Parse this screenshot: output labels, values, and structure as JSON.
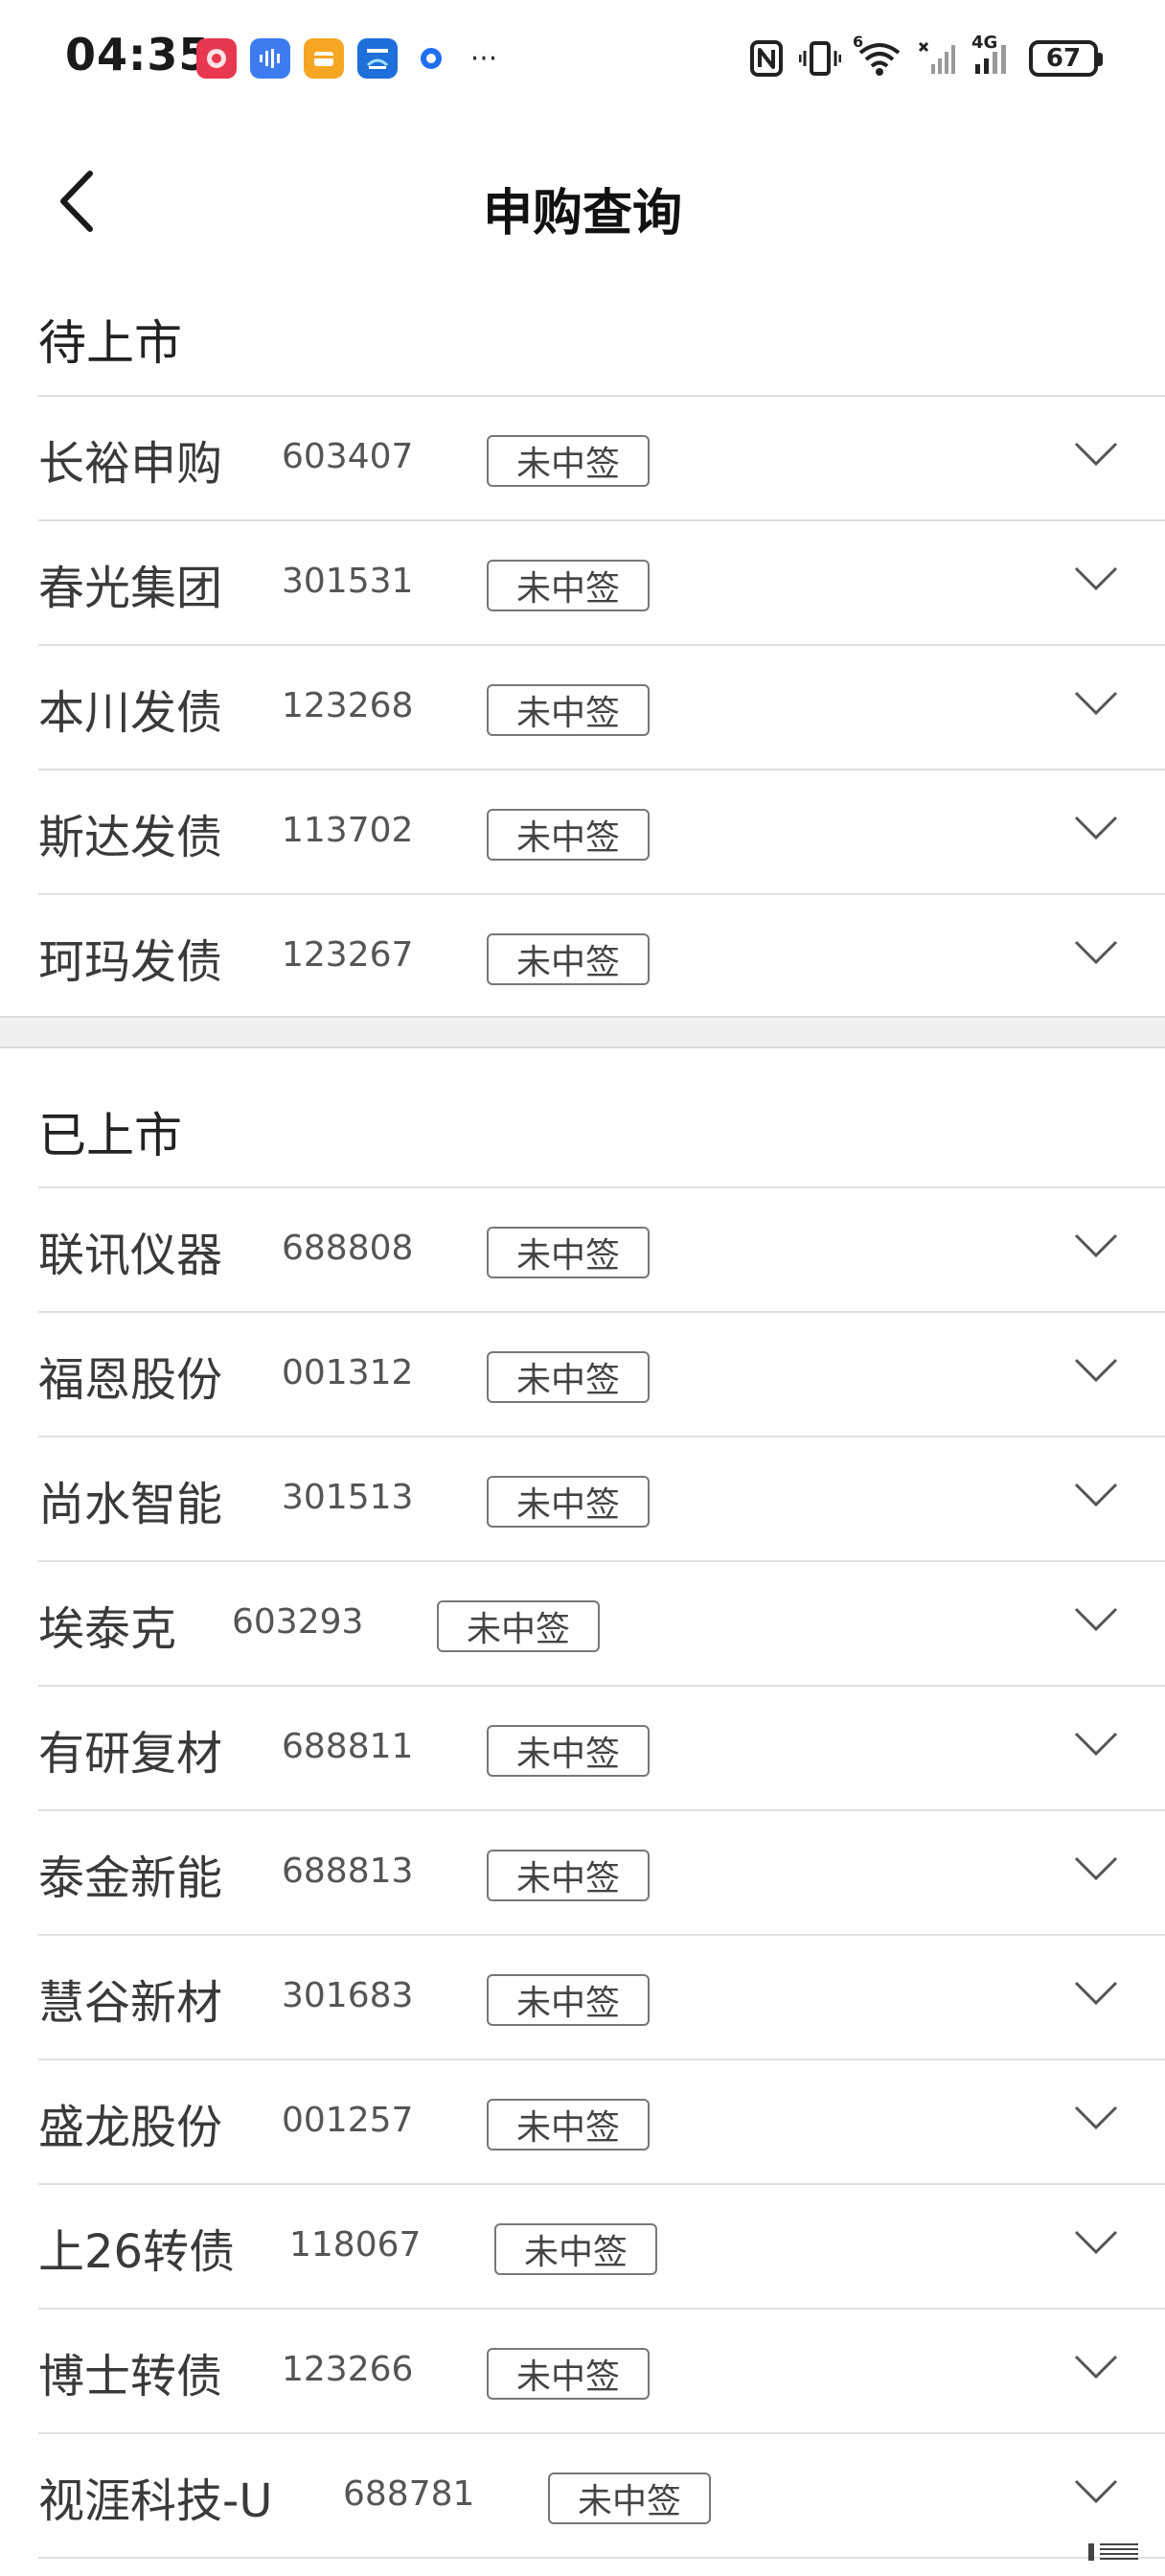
{
  "status_bar": {
    "time": "04:35",
    "more": "···",
    "network": "4G",
    "wifi_badge": "6",
    "battery": "67"
  },
  "header": {
    "title": "申购查询"
  },
  "pending": {
    "title": "待上市",
    "items": [
      {
        "name": "长裕申购",
        "code": "603407",
        "status": "未中签"
      },
      {
        "name": "春光集团",
        "code": "301531",
        "status": "未中签"
      },
      {
        "name": "本川发债",
        "code": "123268",
        "status": "未中签"
      },
      {
        "name": "斯达发债",
        "code": "113702",
        "status": "未中签"
      },
      {
        "name": "珂玛发债",
        "code": "123267",
        "status": "未中签"
      }
    ]
  },
  "listed": {
    "title": "已上市",
    "items": [
      {
        "name": "联讯仪器",
        "code": "688808",
        "status": "未中签"
      },
      {
        "name": "福恩股份",
        "code": "001312",
        "status": "未中签"
      },
      {
        "name": "尚水智能",
        "code": "301513",
        "status": "未中签"
      },
      {
        "name": "埃泰克",
        "code": "603293",
        "status": "未中签"
      },
      {
        "name": "有研复材",
        "code": "688811",
        "status": "未中签"
      },
      {
        "name": "泰金新能",
        "code": "688813",
        "status": "未中签"
      },
      {
        "name": "慧谷新材",
        "code": "301683",
        "status": "未中签"
      },
      {
        "name": "盛龙股份",
        "code": "001257",
        "status": "未中签"
      },
      {
        "name": "上26转债",
        "code": "118067",
        "status": "未中签"
      },
      {
        "name": "博士转债",
        "code": "123266",
        "status": "未中签"
      },
      {
        "name": "视涯科技-U",
        "code": "688781",
        "status": "未中签"
      }
    ]
  },
  "colors": {
    "divider": "#e0e0e0",
    "section_gap": "#f0f0f0",
    "badge_border": "#777777",
    "text": "#3a3a3a"
  }
}
